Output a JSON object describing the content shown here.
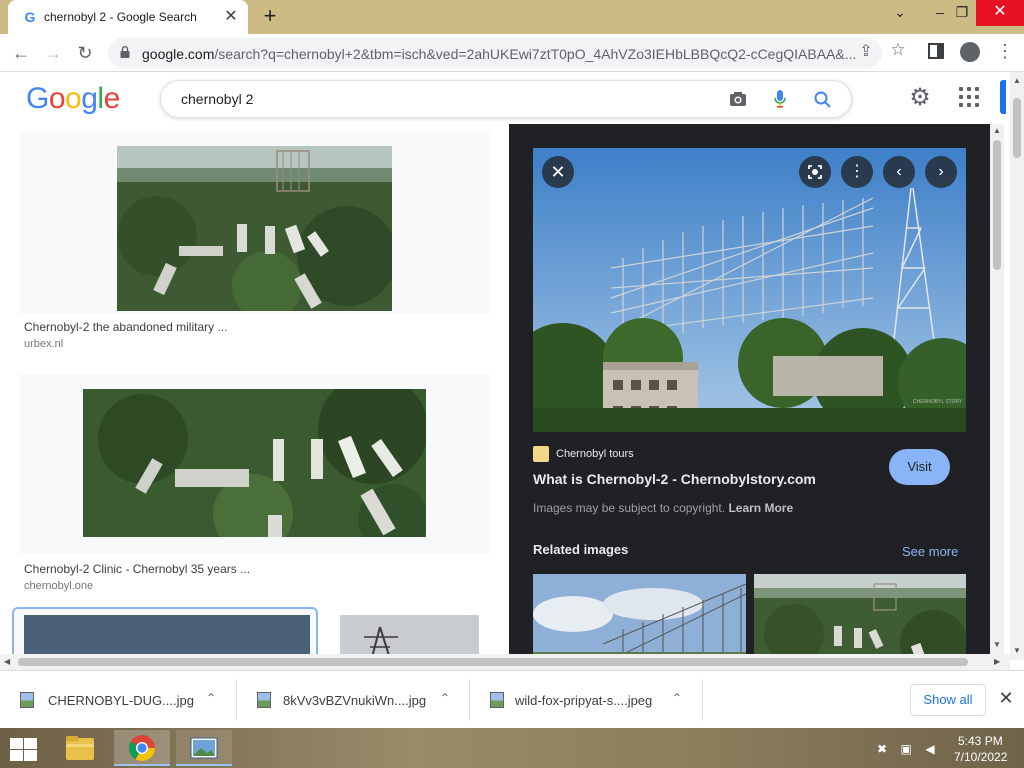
{
  "browser": {
    "tab_title": "chernobyl 2 - Google Search",
    "tab_favicon": "G",
    "url_host": "google.com",
    "url_path": "/search?q=chernobyl+2&tbm=isch&ved=2ahUKEwi7ztT0pO_4AhVZo3IEHbLBBQcQ2-cCegQIABAA&..."
  },
  "google": {
    "logo": [
      "G",
      "o",
      "o",
      "g",
      "l",
      "e"
    ],
    "search_query": "chernobyl 2"
  },
  "results": [
    {
      "title": "Chernobyl-2 the abandoned military ...",
      "source": "urbex.nl"
    },
    {
      "title": "Chernobyl-2 Clinic - Chernobyl 35 years ...",
      "source": "chernobyl.one"
    }
  ],
  "viewer": {
    "site_name": "Chernobyl tours",
    "headline": "What is Chernobyl-2 - Chernobylstory.com",
    "copyright_note": "Images may be subject to copyright.",
    "learn_more": "Learn More",
    "visit_label": "Visit",
    "related_heading": "Related images",
    "see_more": "See more",
    "watermark": "CHERNOBYL STORY"
  },
  "downloads": {
    "items": [
      {
        "name": "CHERNOBYL-DUG....jpg"
      },
      {
        "name": "8kVv3vBZVnukiWn....jpg"
      },
      {
        "name": "wild-fox-pripyat-s....jpeg"
      }
    ],
    "show_all": "Show all"
  },
  "taskbar": {
    "time": "5:43 PM",
    "date": "7/10/2022"
  },
  "colors": {
    "accent": "#1a73e8",
    "viewer_bg": "#202124",
    "visit_button": "#8ab4f8",
    "titlebar": "#cdbb86",
    "close_red": "#e81123"
  }
}
